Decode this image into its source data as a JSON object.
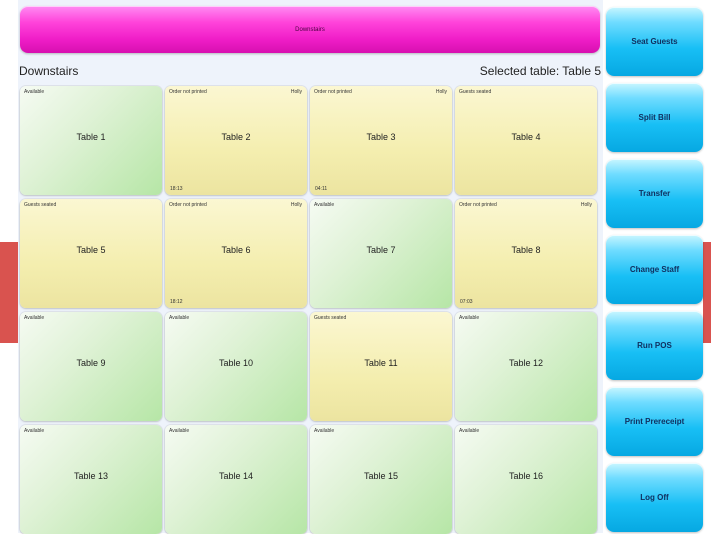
{
  "banner": {
    "label": "Downstairs"
  },
  "header": {
    "area_name": "Downstairs",
    "selected_label": "Selected table: Table 5"
  },
  "tables": [
    {
      "name": "Table 1",
      "status": "Available",
      "staff": "",
      "time": ""
    },
    {
      "name": "Table 2",
      "status": "Order not printed",
      "staff": "Holly",
      "time": "18:13"
    },
    {
      "name": "Table 3",
      "status": "Order not printed",
      "staff": "Holly",
      "time": "04:11"
    },
    {
      "name": "Table 4",
      "status": "Guests seated",
      "staff": "",
      "time": ""
    },
    {
      "name": "Table 5",
      "status": "Guests seated",
      "staff": "",
      "time": ""
    },
    {
      "name": "Table 6",
      "status": "Order not printed",
      "staff": "Holly",
      "time": "18:12"
    },
    {
      "name": "Table 7",
      "status": "Available",
      "staff": "",
      "time": ""
    },
    {
      "name": "Table 8",
      "status": "Order not printed",
      "staff": "Holly",
      "time": "07:03"
    },
    {
      "name": "Table 9",
      "status": "Available",
      "staff": "",
      "time": ""
    },
    {
      "name": "Table 10",
      "status": "Available",
      "staff": "",
      "time": ""
    },
    {
      "name": "Table 11",
      "status": "Guests seated",
      "staff": "",
      "time": ""
    },
    {
      "name": "Table 12",
      "status": "Available",
      "staff": "",
      "time": ""
    },
    {
      "name": "Table 13",
      "status": "Available",
      "staff": "",
      "time": ""
    },
    {
      "name": "Table 14",
      "status": "Available",
      "staff": "",
      "time": ""
    },
    {
      "name": "Table 15",
      "status": "Available",
      "staff": "",
      "time": ""
    },
    {
      "name": "Table 16",
      "status": "Available",
      "staff": "",
      "time": ""
    }
  ],
  "actions": {
    "seat_guests": "Seat Guests",
    "split_bill": "Split Bill",
    "transfer": "Transfer",
    "change_staff": "Change Staff",
    "run_pos": "Run POS",
    "print_prereceipt": "Print Prereceipt",
    "log_off": "Log Off"
  },
  "colors": {
    "available": "#c8ecbc",
    "occupied": "#f4eeaf",
    "banner": "#f01ec8",
    "action": "#18bff5",
    "side_accent": "#d9534f"
  }
}
